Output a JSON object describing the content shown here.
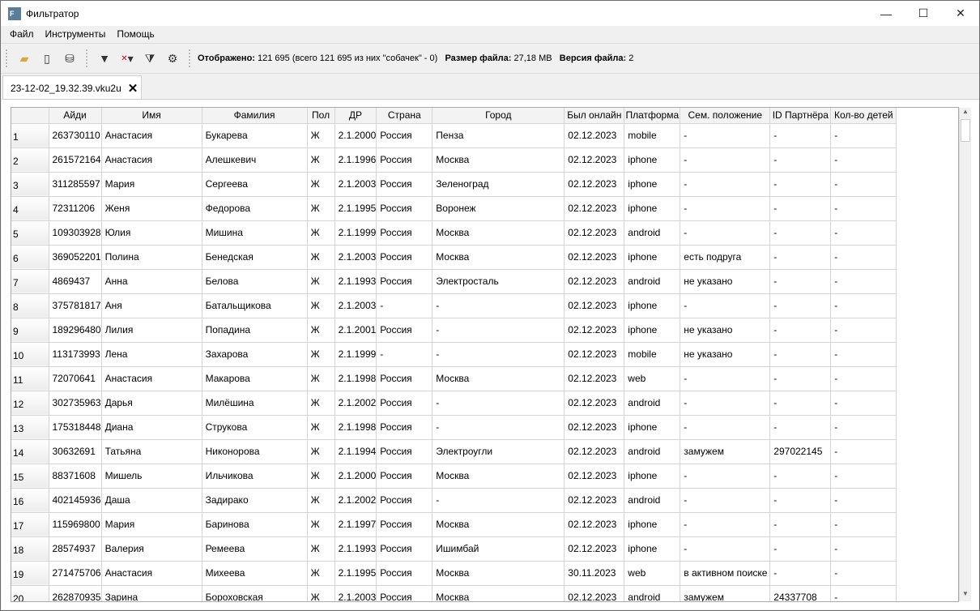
{
  "window": {
    "title": "Фильтратор",
    "minimize": "—",
    "maximize": "☐",
    "close": "✕"
  },
  "menu": [
    "Файл",
    "Инструменты",
    "Помощь"
  ],
  "toolbar": {
    "status_label_shown": "Отображено:",
    "status_shown": "121 695 (всего 121 695 из них \"собачек\" - 0)",
    "size_label": "Размер файла:",
    "size": "27,18 MB",
    "version_label": "Версия файла:",
    "version": "2"
  },
  "tab": {
    "label": "23-12-02_19.32.39.vku2u",
    "close": "✕"
  },
  "table": {
    "columns": [
      "",
      "Айди",
      "Имя",
      "Фамилия",
      "Пол",
      "ДР",
      "Страна",
      "Город",
      "Был онлайн",
      "Платформа",
      "Сем. положение",
      "ID Партнёра",
      "Кол-во детей"
    ],
    "rows": [
      [
        "1",
        "263730110",
        "Анастасия",
        "Букарева",
        "Ж",
        "2.1.2000",
        "Россия",
        "Пенза",
        "02.12.2023",
        "mobile",
        "-",
        "-",
        "-"
      ],
      [
        "2",
        "261572164",
        "Анастасия",
        "Алешкевич",
        "Ж",
        "2.1.1996",
        "Россия",
        "Москва",
        "02.12.2023",
        "iphone",
        "-",
        "-",
        "-"
      ],
      [
        "3",
        "311285597",
        "Мария",
        "Сергеева",
        "Ж",
        "2.1.2003",
        "Россия",
        "Зеленоград",
        "02.12.2023",
        "iphone",
        "-",
        "-",
        "-"
      ],
      [
        "4",
        "72311206",
        "Женя",
        "Федорова",
        "Ж",
        "2.1.1995",
        "Россия",
        "Воронеж",
        "02.12.2023",
        "iphone",
        "-",
        "-",
        "-"
      ],
      [
        "5",
        "109303928",
        "Юлия",
        "Мишина",
        "Ж",
        "2.1.1999",
        "Россия",
        "Москва",
        "02.12.2023",
        "android",
        "-",
        "-",
        "-"
      ],
      [
        "6",
        "369052201",
        "Полина",
        "Бенедская",
        "Ж",
        "2.1.2003",
        "Россия",
        "Москва",
        "02.12.2023",
        "iphone",
        "есть подруга",
        "-",
        "-"
      ],
      [
        "7",
        "4869437",
        "Анна",
        "Белова",
        "Ж",
        "2.1.1993",
        "Россия",
        "Электросталь",
        "02.12.2023",
        "android",
        "не указано",
        "-",
        "-"
      ],
      [
        "8",
        "375781817",
        "Аня",
        "Батальщикова",
        "Ж",
        "2.1.2003",
        "-",
        "-",
        "02.12.2023",
        "iphone",
        "-",
        "-",
        "-"
      ],
      [
        "9",
        "189296480",
        "Лилия",
        "Попадина",
        "Ж",
        "2.1.2001",
        "Россия",
        "-",
        "02.12.2023",
        "iphone",
        "не указано",
        "-",
        "-"
      ],
      [
        "10",
        "113173993",
        "Лена",
        "Захарова",
        "Ж",
        "2.1.1999",
        "-",
        "-",
        "02.12.2023",
        "mobile",
        "не указано",
        "-",
        "-"
      ],
      [
        "11",
        "72070641",
        "Анастасия",
        "Макарова",
        "Ж",
        "2.1.1998",
        "Россия",
        "Москва",
        "02.12.2023",
        "web",
        "-",
        "-",
        "-"
      ],
      [
        "12",
        "302735963",
        "Дарья",
        "Милёшина",
        "Ж",
        "2.1.2002",
        "Россия",
        "-",
        "02.12.2023",
        "android",
        "-",
        "-",
        "-"
      ],
      [
        "13",
        "175318448",
        "Диана",
        "Струкова",
        "Ж",
        "2.1.1998",
        "Россия",
        "-",
        "02.12.2023",
        "iphone",
        "-",
        "-",
        "-"
      ],
      [
        "14",
        "30632691",
        "Татьяна",
        "Никонорова",
        "Ж",
        "2.1.1994",
        "Россия",
        "Электроугли",
        "02.12.2023",
        "android",
        "замужем",
        "297022145",
        "-"
      ],
      [
        "15",
        "88371608",
        "Мишель",
        "Ильчикова",
        "Ж",
        "2.1.2000",
        "Россия",
        "Москва",
        "02.12.2023",
        "iphone",
        "-",
        "-",
        "-"
      ],
      [
        "16",
        "402145936",
        "Даша",
        "Задирако",
        "Ж",
        "2.1.2002",
        "Россия",
        "-",
        "02.12.2023",
        "android",
        "-",
        "-",
        "-"
      ],
      [
        "17",
        "115969800",
        "Мария",
        "Баринова",
        "Ж",
        "2.1.1997",
        "Россия",
        "Москва",
        "02.12.2023",
        "iphone",
        "-",
        "-",
        "-"
      ],
      [
        "18",
        "28574937",
        "Валерия",
        "Ремеева",
        "Ж",
        "2.1.1993",
        "Россия",
        "Ишимбай",
        "02.12.2023",
        "iphone",
        "-",
        "-",
        "-"
      ],
      [
        "19",
        "271475706",
        "Анастасия",
        "Михеева",
        "Ж",
        "2.1.1995",
        "Россия",
        "Москва",
        "30.11.2023",
        "web",
        "в активном поиске",
        "-",
        "-"
      ],
      [
        "20",
        "262870935",
        "Зарина",
        "Бороховская",
        "Ж",
        "2.1.2003",
        "Россия",
        "Москва",
        "02.12.2023",
        "android",
        "замужем",
        "24337708",
        "-"
      ]
    ]
  }
}
